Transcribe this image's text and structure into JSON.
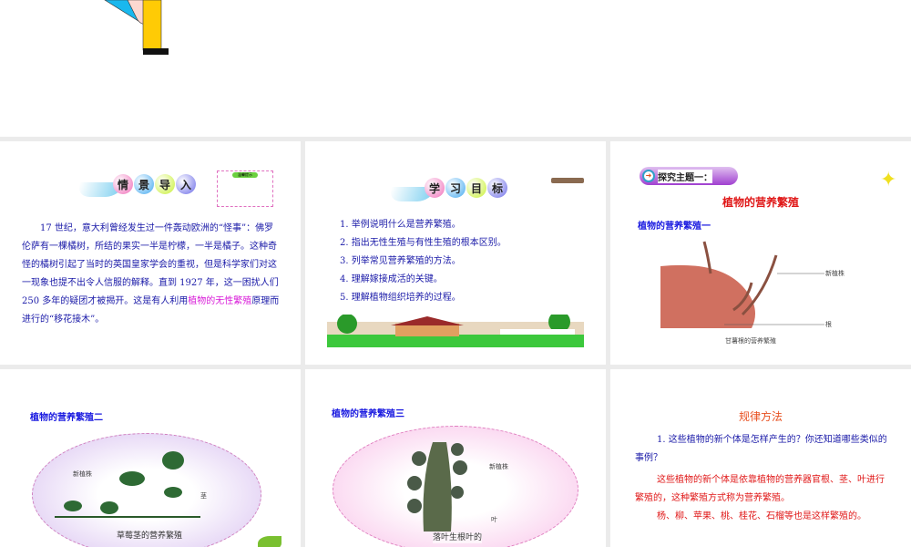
{
  "slide1": {
    "header_chars": [
      "情",
      "景",
      "导",
      "入"
    ],
    "note_title": "温馨提示",
    "paragraph_before": "17 世纪，意大利曾经发生过一件轰动欧洲的“怪事”：佛罗伦萨有一棵橘树，所结的果实一半是柠檬，一半是橘子。这种奇怪的橘树引起了当时的英国皇家学会的重视，但是科学家们对这一现象也提不出令人信服的解释。直到 1927 年，这一困扰人们 250 多年的疑团才被揭开。这是有人利用",
    "paragraph_highlight": "植物的无性繁殖",
    "paragraph_after": "原理而进行的“移花接木”。"
  },
  "slide2": {
    "header_chars": [
      "学",
      "习",
      "目",
      "标"
    ],
    "objectives": [
      "1. 举例说明什么是营养繁殖。",
      "2. 指出无性生殖与有性生殖的根本区别。",
      "3. 列举常见营养繁殖的方法。",
      "4. 理解嫁接成活的关键。",
      "5. 理解植物组织培养的过程。"
    ]
  },
  "slide3": {
    "badge": "探究主题一：",
    "title": "植物的营养繁殖",
    "subtitle": "植物的营养繁殖一",
    "label_new": "新植株",
    "label_root": "根",
    "caption": "甘薯根的营养繁殖"
  },
  "slide4": {
    "subtitle": "植物的营养繁殖二",
    "label_new": "新植株",
    "label_stem": "茎",
    "caption": "草莓茎的营养繁殖"
  },
  "slide5": {
    "subtitle": "植物的营养繁殖三",
    "label_new": "新植株",
    "label_leaf": "叶",
    "caption": "落叶生根叶的"
  },
  "slide6": {
    "title": "规律方法",
    "question": "1. 这些植物的新个体是怎样产生的？你还知道哪些类似的事例？",
    "answer1": "这些植物的新个体是依靠植物的营养器官根、茎、叶进行繁殖的，这种繁殖方式称为营养繁殖。",
    "answer2": "杨、柳、苹果、桃、桂花、石榴等也是这样繁殖的。"
  }
}
